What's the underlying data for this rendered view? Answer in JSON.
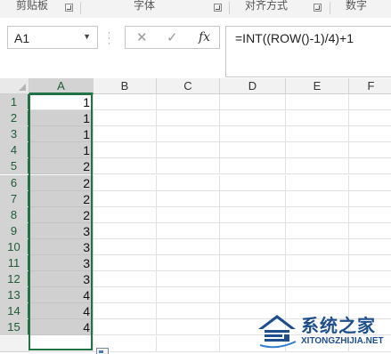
{
  "ribbon": {
    "groups": [
      "剪贴板",
      "字体",
      "对齐方式",
      "数字"
    ]
  },
  "name_box": {
    "value": "A1"
  },
  "formula_bar": {
    "formula": "=INT((ROW()-1)/4)+1",
    "cancel_icon": "✕",
    "enter_icon": "✓",
    "fx_label": "fx"
  },
  "columns": [
    "A",
    "B",
    "C",
    "D",
    "E",
    "F"
  ],
  "rows": [
    {
      "num": "1",
      "a": "1"
    },
    {
      "num": "2",
      "a": "1"
    },
    {
      "num": "3",
      "a": "1"
    },
    {
      "num": "4",
      "a": "1"
    },
    {
      "num": "5",
      "a": "2"
    },
    {
      "num": "6",
      "a": "2"
    },
    {
      "num": "7",
      "a": "2"
    },
    {
      "num": "8",
      "a": "2"
    },
    {
      "num": "9",
      "a": "3"
    },
    {
      "num": "10",
      "a": "3"
    },
    {
      "num": "11",
      "a": "3"
    },
    {
      "num": "12",
      "a": "3"
    },
    {
      "num": "13",
      "a": "4"
    },
    {
      "num": "14",
      "a": "4"
    },
    {
      "num": "15",
      "a": "4"
    },
    {
      "num": "",
      "a": ""
    }
  ],
  "selection": {
    "range": "A1:A15",
    "active": "A1"
  },
  "colors": {
    "accent": "#217346",
    "selection_fill": "#d0d0d0"
  },
  "watermark": {
    "title": "系统之家",
    "url": "XITONGZHIJIA.NET"
  }
}
